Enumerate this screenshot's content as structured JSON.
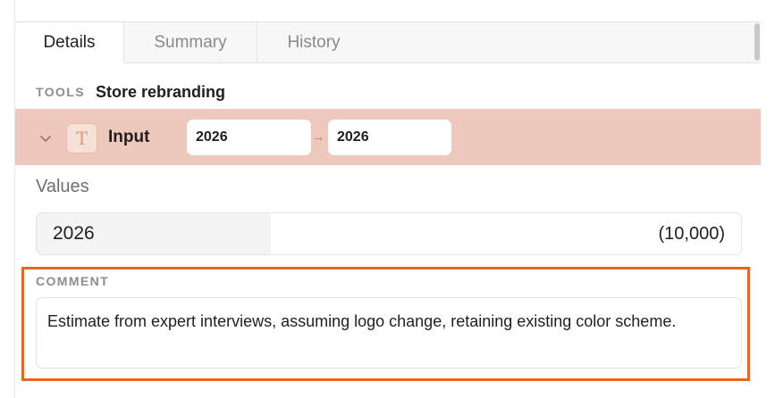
{
  "tabs": [
    {
      "label": "Details",
      "active": true
    },
    {
      "label": "Summary",
      "active": false
    },
    {
      "label": "History",
      "active": false
    }
  ],
  "breadcrumb": {
    "category": "TOOLS",
    "name": "Store rebranding"
  },
  "input_row": {
    "label": "Input",
    "type_icon": "T",
    "from_value": "2026",
    "arrow": "→",
    "to_value": "2026",
    "highlight_color": "#efc8bd"
  },
  "values": {
    "heading": "Values",
    "year": "2026",
    "amount": "(10,000)"
  },
  "comment": {
    "label": "COMMENT",
    "text": "Estimate from expert interviews, assuming logo change, retaining existing color scheme.",
    "frame_color": "#ea6522"
  }
}
